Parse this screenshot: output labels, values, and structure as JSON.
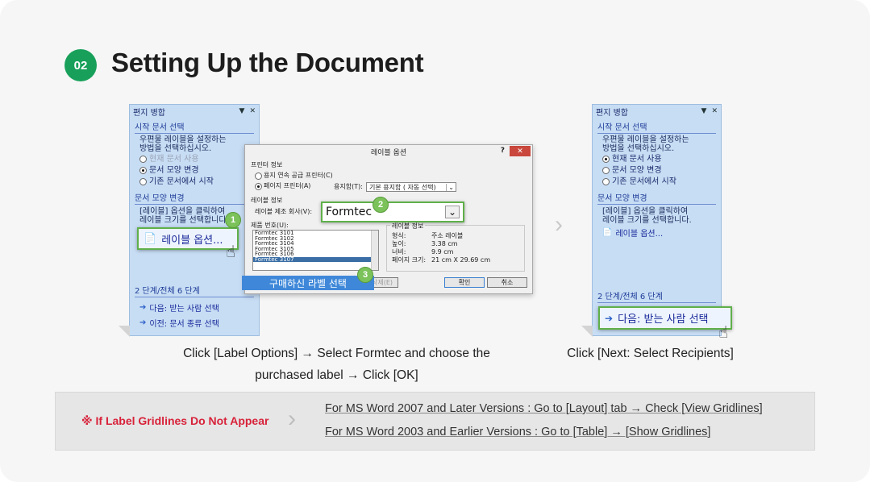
{
  "step": {
    "number": "02",
    "title": "Setting Up the Document"
  },
  "pane_left": {
    "title": "편지 병합",
    "section_start": "시작 문서 선택",
    "start_desc_1": "우편물 레이블을 설정하는",
    "start_desc_2": "방법을 선택하십시오.",
    "radio_current": "현재 문서 사용",
    "radio_change": "문서 모양 변경",
    "radio_existing": "기존 문서에서 시작",
    "section_change": "문서 모양 변경",
    "change_desc_1": "[레이블] 옵션을 클릭하여",
    "change_desc_2": "레이블 크기를 선택합니다",
    "label_options": "레이블 옵션...",
    "step_count": "2 단계/전체 6 단계",
    "next": "다음: 받는 사람 선택",
    "prev": "이전: 문서 종류 선택"
  },
  "dialog": {
    "title": "레이블 옵션",
    "help": "?",
    "close": "✕",
    "printer_info": "프린터 정보",
    "continuous": "용지 연속 공급 프린터(C)",
    "page_printer": "페이지 프린터(A)",
    "tray_label": "용지함(T):",
    "tray_value": "기본 용지함 ( 자동 선택)",
    "label_info": "레이블 정보",
    "vendor_label": "레이블 제조 회사(V):",
    "vendor_value": "Formtec",
    "product_label": "제품 번호(U):",
    "products": [
      "Formtec 3101",
      "Formtec 3102",
      "Formtec 3104",
      "Formtec 3105",
      "Formtec 3106",
      "Formtec 3107"
    ],
    "info_title": "레이블 정보",
    "info_type_k": "형식:",
    "info_type_v": "주소 레이블",
    "info_height_k": "높이:",
    "info_height_v": "3.38 cm",
    "info_width_k": "너비:",
    "info_width_v": "9.9 cm",
    "info_page_k": "페이지 크기:",
    "info_page_v": "21 cm X 29.69 cm",
    "delete_btn": "삭제(E)",
    "ok": "확인",
    "cancel": "취소",
    "purchased_tip": "구매하신 라벨 선택"
  },
  "pane_right": {
    "title": "편지 병합",
    "section_start": "시작 문서 선택",
    "start_desc_1": "우편물 레이블을 설정하는",
    "start_desc_2": "방법을 선택하십시오.",
    "radio_current": "현재 문서 사용",
    "radio_change": "문서 모양 변경",
    "radio_existing": "기존 문서에서 시작",
    "section_change": "문서 모양 변경",
    "change_desc_1": "[레이블] 옵션을 클릭하여",
    "change_desc_2": "레이블 크기를 선택합니다.",
    "label_options": "레이블 옵션...",
    "step_count": "2 단계/전체 6 단계",
    "next": "다음: 받는 사람 선택"
  },
  "badges": {
    "one": "1",
    "two": "2",
    "three": "3"
  },
  "captions": {
    "left_1": "Click [Label Options] → Select Formtec and choose the",
    "left_2": "purchased label → Click [OK]",
    "right": "Click [Next: Select Recipients]"
  },
  "note": {
    "label": "※ If Label Gridlines Do Not Appear",
    "line_1": "For MS Word 2007 and Later Versions : Go to [Layout] tab → Check [View Gridlines]",
    "line_2": "For MS Word 2003 and Earlier Versions : Go to [Table] → [Show Gridlines]"
  },
  "colors": {
    "accent_green": "#18a05a",
    "note_red": "#d8223a",
    "pane_blue": "#c7ddf4"
  }
}
